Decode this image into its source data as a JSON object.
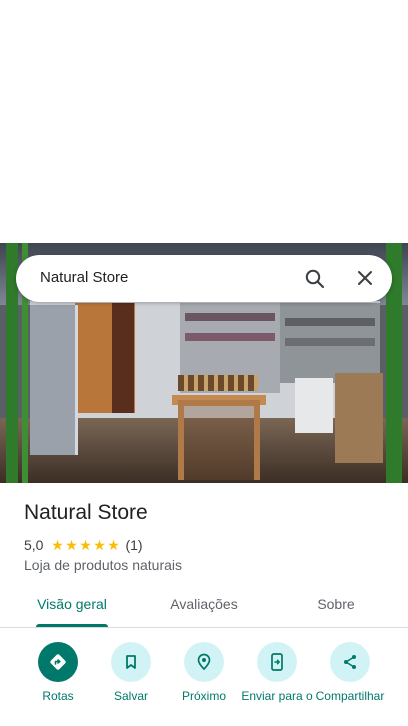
{
  "search": {
    "query": "Natural Store"
  },
  "place": {
    "title": "Natural Store",
    "rating": "5,0",
    "stars": 5,
    "review_count": "(1)",
    "category": "Loja de produtos naturais"
  },
  "tabs": [
    {
      "label": "Visão geral",
      "active": true
    },
    {
      "label": "Avaliações",
      "active": false
    },
    {
      "label": "Sobre",
      "active": false
    }
  ],
  "actions": [
    {
      "label": "Rotas",
      "icon": "directions-icon",
      "primary": true
    },
    {
      "label": "Salvar",
      "icon": "bookmark-icon",
      "primary": false
    },
    {
      "label": "Próximo",
      "icon": "nearby-icon",
      "primary": false
    },
    {
      "label": "Enviar para o",
      "icon": "send-to-phone-icon",
      "primary": false
    },
    {
      "label": "Compartilhar",
      "icon": "share-icon",
      "primary": false
    }
  ],
  "colors": {
    "accent": "#00796b",
    "action_bg": "#d2f3f5",
    "star": "#fbbc04"
  }
}
